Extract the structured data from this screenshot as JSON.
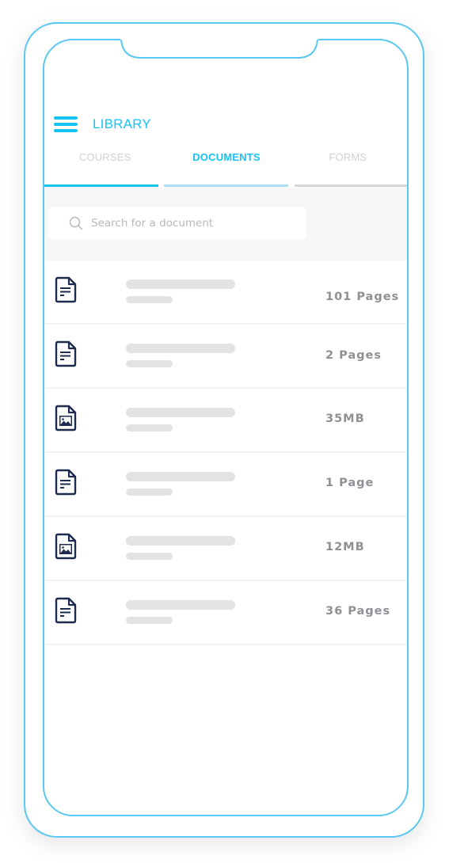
{
  "colors": {
    "accent": "#17c3f5",
    "frame": "#5bc8f2",
    "icon": "#1d2b4f",
    "meta_text": "#8e9096",
    "skeleton": "#e3e3e3"
  },
  "header": {
    "menu_icon": "hamburger-menu-icon",
    "title": "LIBRARY"
  },
  "tabs": [
    {
      "label": "COURSES",
      "active": false
    },
    {
      "label": "DOCUMENTS",
      "active": true
    },
    {
      "label": "FORMS",
      "active": false
    }
  ],
  "search": {
    "icon": "search-icon",
    "placeholder": "Search for a document",
    "value": ""
  },
  "documents": [
    {
      "icon": "text-document-icon",
      "meta": "101 Pages"
    },
    {
      "icon": "text-document-icon",
      "meta": "2 Pages"
    },
    {
      "icon": "image-document-icon",
      "meta": "35MB"
    },
    {
      "icon": "text-document-icon",
      "meta": "1 Page"
    },
    {
      "icon": "image-document-icon",
      "meta": "12MB"
    },
    {
      "icon": "text-document-icon",
      "meta": "36 Pages"
    }
  ]
}
